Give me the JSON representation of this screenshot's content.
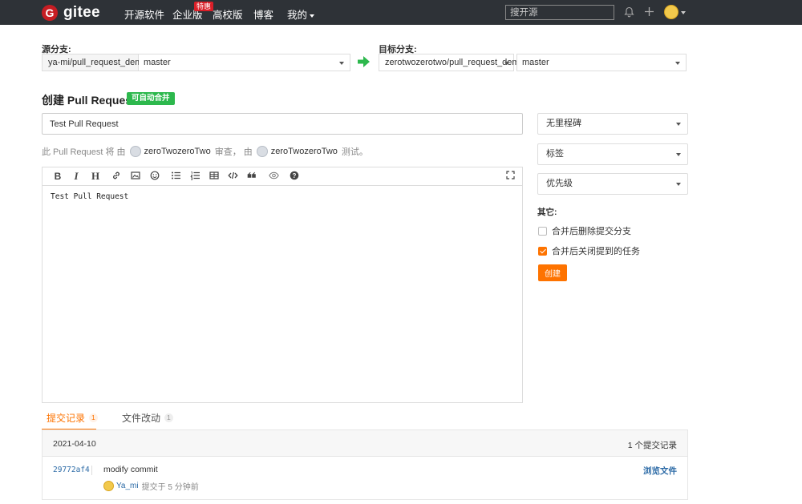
{
  "header": {
    "logo_glyph": "G",
    "logo_text": "gitee",
    "nav": [
      "开源软件",
      "企业版",
      "高校版",
      "博客",
      "我的"
    ],
    "badge": "特惠",
    "search_placeholder": "搜开源",
    "icons": [
      "bell-icon",
      "plus-icon",
      "avatar"
    ]
  },
  "branches": {
    "source_label": "源分支:",
    "source_repo": "ya-mi/pull_request_demo",
    "source_branch": "master",
    "target_label": "目标分支:",
    "target_repo": "zerotwozerotwo/pull_request_demo",
    "target_branch": "master"
  },
  "pr": {
    "heading": "创建 Pull Request",
    "merge_badge": "可自动合并",
    "title_value": "Test Pull Request",
    "review_prefix": "此 Pull Request 将 由",
    "reviewer": "zeroTwozeroTwo",
    "review_mid": "审查， 由",
    "tester": "zeroTwozeroTwo",
    "review_suffix": "测试。",
    "body": "Test Pull Request"
  },
  "toolbar_icons": [
    "bold-icon",
    "italic-icon",
    "heading-icon",
    "link-icon",
    "image-icon",
    "emoji-icon",
    "unordered-list-icon",
    "ordered-list-icon",
    "table-icon",
    "code-icon",
    "quote-icon",
    "preview-icon",
    "help-icon",
    "fullscreen-icon"
  ],
  "toolbar_glyphs": {
    "bold": "B",
    "italic": "I",
    "heading": "H"
  },
  "side": {
    "milestone": "无里程碑",
    "labels": "标签",
    "priority": "优先级",
    "other_label": "其它:",
    "delete_branch": "合并后删除提交分支",
    "delete_branch_checked": false,
    "close_issues": "合并后关闭提到的任务",
    "close_issues_checked": true,
    "create_button": "创建"
  },
  "tabs": [
    {
      "label": "提交记录",
      "count": "1",
      "active": true
    },
    {
      "label": "文件改动",
      "count": "1",
      "active": false
    }
  ],
  "commits": {
    "date": "2021-04-10",
    "count_text": "1 个提交记录",
    "items": [
      {
        "sha": "29772af4",
        "message": "modify commit",
        "author": "Ya_mi",
        "time": "提交于 5 分钟前",
        "browse": "浏览文件"
      }
    ]
  },
  "colors": {
    "header_bg": "#2e3237",
    "accent": "#fe7300",
    "badge_green": "#2db84d",
    "link": "#2b6aa6"
  }
}
